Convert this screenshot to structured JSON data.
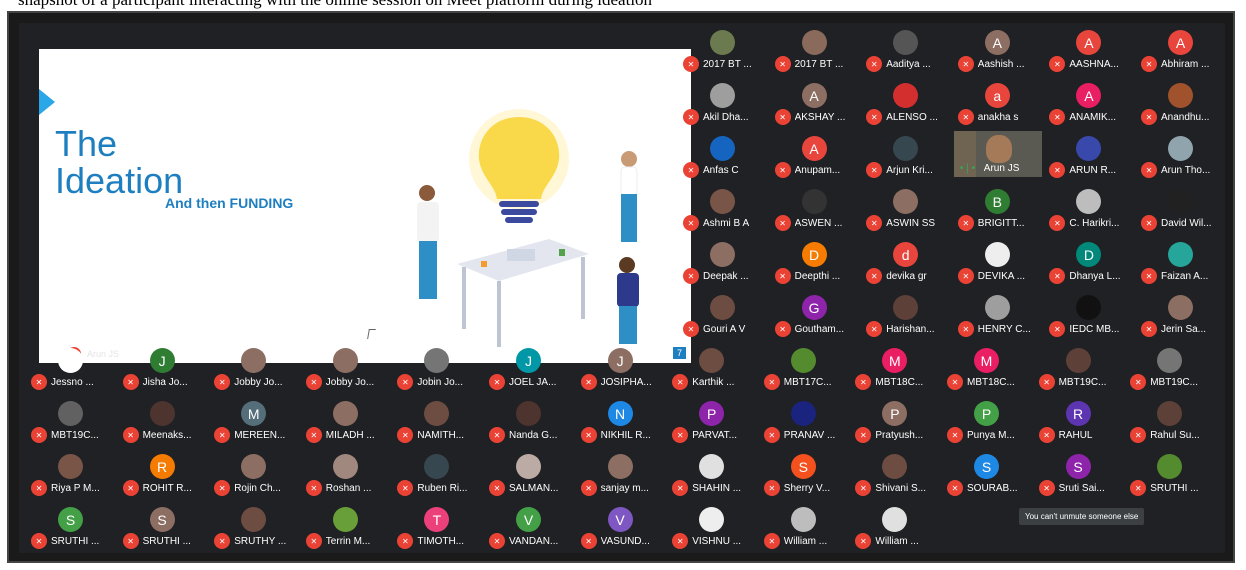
{
  "top_caption": "snapshot of a participant interacting with the online session on Meet platform during ideation",
  "slide": {
    "title_lines": [
      "The",
      "Ideation"
    ],
    "subtitle": "And then FUNDING",
    "page_number": "7",
    "presenter": "Arun JS"
  },
  "tooltip": "You can't unmute someone else",
  "colors": {
    "mute_red": "#ea4335",
    "slide_blue": "#1e7fc0",
    "meet_bg": "#202124"
  },
  "participants": [
    {
      "name": "2017 BT ...",
      "initial": "",
      "avatar_color": "#6b7b4f",
      "video": false
    },
    {
      "name": "2017 BT ...",
      "initial": "",
      "avatar_color": "#8a6a5a",
      "video": false
    },
    {
      "name": "Aaditya ...",
      "initial": "",
      "avatar_color": "#555555",
      "video": false
    },
    {
      "name": "Aashish ...",
      "initial": "A",
      "avatar_color": "#8d6e63",
      "video": false
    },
    {
      "name": "AASHNA...",
      "initial": "A",
      "avatar_color": "#e8453c",
      "video": false
    },
    {
      "name": "Abhiram ...",
      "initial": "A",
      "avatar_color": "#e8453c",
      "video": false
    },
    {
      "name": "Akil Dha...",
      "initial": "",
      "avatar_color": "#9e9e9e",
      "video": false
    },
    {
      "name": "AKSHAY ...",
      "initial": "A",
      "avatar_color": "#8d6e63",
      "video": false
    },
    {
      "name": "ALENSO ...",
      "initial": "",
      "avatar_color": "#d32f2f",
      "video": false
    },
    {
      "name": "anakha s",
      "initial": "a",
      "avatar_color": "#e8453c",
      "video": false
    },
    {
      "name": "ANAMIK...",
      "initial": "A",
      "avatar_color": "#e91e63",
      "video": false
    },
    {
      "name": "Anandhu...",
      "initial": "",
      "avatar_color": "#a0522d",
      "video": false
    },
    {
      "name": "Anfas C",
      "initial": "",
      "avatar_color": "#1565c0",
      "video": false
    },
    {
      "name": "Anupam...",
      "initial": "A",
      "avatar_color": "#e8453c",
      "video": false
    },
    {
      "name": "Arjun Kri...",
      "initial": "",
      "avatar_color": "#37474f",
      "video": false
    },
    {
      "name": "Arun JS",
      "initial": "",
      "avatar_color": "#5a5a52",
      "video": true
    },
    {
      "name": "ARUN R...",
      "initial": "",
      "avatar_color": "#3949ab",
      "video": false
    },
    {
      "name": "Arun Tho...",
      "initial": "",
      "avatar_color": "#90a4ae",
      "video": false
    },
    {
      "name": "Ashmi B A",
      "initial": "",
      "avatar_color": "#795548",
      "video": false
    },
    {
      "name": "ASWEN ...",
      "initial": "",
      "avatar_color": "#333333",
      "video": false
    },
    {
      "name": "ASWIN SS",
      "initial": "",
      "avatar_color": "#8d6e63",
      "video": false
    },
    {
      "name": "BRIGITT...",
      "initial": "B",
      "avatar_color": "#2e7d32",
      "video": false
    },
    {
      "name": "C. Harikri...",
      "initial": "",
      "avatar_color": "#bdbdbd",
      "video": false
    },
    {
      "name": "David Wil...",
      "initial": "",
      "avatar_color": "#212121",
      "video": false
    },
    {
      "name": "Deepak ...",
      "initial": "",
      "avatar_color": "#8d6e63",
      "video": false
    },
    {
      "name": "Deepthi ...",
      "initial": "D",
      "avatar_color": "#f57c00",
      "video": false
    },
    {
      "name": "devika gr",
      "initial": "d",
      "avatar_color": "#e8453c",
      "video": false
    },
    {
      "name": "DEVIKA ...",
      "initial": "",
      "avatar_color": "#eeeeee",
      "video": false
    },
    {
      "name": "Dhanya L...",
      "initial": "D",
      "avatar_color": "#00897b",
      "video": false
    },
    {
      "name": "Faizan A...",
      "initial": "",
      "avatar_color": "#26a69a",
      "video": false
    },
    {
      "name": "Gouri A V",
      "initial": "",
      "avatar_color": "#6d4c41",
      "video": false
    },
    {
      "name": "Goutham...",
      "initial": "G",
      "avatar_color": "#8e24aa",
      "video": false
    },
    {
      "name": "Harishan...",
      "initial": "",
      "avatar_color": "#5d4037",
      "video": false
    },
    {
      "name": "HENRY C...",
      "initial": "",
      "avatar_color": "#9e9e9e",
      "video": false
    },
    {
      "name": "IEDC MB...",
      "initial": "",
      "avatar_color": "#111111",
      "video": false
    },
    {
      "name": "Jerin Sa...",
      "initial": "",
      "avatar_color": "#8d6e63",
      "video": false
    },
    {
      "name": "Jessno ...",
      "initial": "",
      "avatar_color": "#ffffff",
      "video": false
    },
    {
      "name": "Jisha Jo...",
      "initial": "J",
      "avatar_color": "#2e7d32",
      "video": false
    },
    {
      "name": "Jobby Jo...",
      "initial": "",
      "avatar_color": "#8d6e63",
      "video": false
    },
    {
      "name": "Jobby Jo...",
      "initial": "",
      "avatar_color": "#8d6e63",
      "video": false
    },
    {
      "name": "Jobin Jo...",
      "initial": "",
      "avatar_color": "#757575",
      "video": false
    },
    {
      "name": "JOEL JA...",
      "initial": "J",
      "avatar_color": "#0097a7",
      "video": false
    },
    {
      "name": "JOSIPHA...",
      "initial": "J",
      "avatar_color": "#8d6e63",
      "video": false
    },
    {
      "name": "Karthik ...",
      "initial": "",
      "avatar_color": "#6d4c41",
      "video": false
    },
    {
      "name": "MBT17C...",
      "initial": "",
      "avatar_color": "#558b2f",
      "video": false
    },
    {
      "name": "MBT18C...",
      "initial": "M",
      "avatar_color": "#e91e63",
      "video": false
    },
    {
      "name": "MBT18C...",
      "initial": "M",
      "avatar_color": "#e91e63",
      "video": false
    },
    {
      "name": "MBT19C...",
      "initial": "",
      "avatar_color": "#5d4037",
      "video": false
    },
    {
      "name": "MBT19C...",
      "initial": "",
      "avatar_color": "#757575",
      "video": false
    },
    {
      "name": "MBT19C...",
      "initial": "",
      "avatar_color": "#616161",
      "video": false
    },
    {
      "name": "Meenaks...",
      "initial": "",
      "avatar_color": "#4e342e",
      "video": false
    },
    {
      "name": "MEREEN...",
      "initial": "M",
      "avatar_color": "#546e7a",
      "video": false
    },
    {
      "name": "MILADH ...",
      "initial": "",
      "avatar_color": "#8d6e63",
      "video": false
    },
    {
      "name": "NAMITH...",
      "initial": "",
      "avatar_color": "#6d4c41",
      "video": false
    },
    {
      "name": "Nanda G...",
      "initial": "",
      "avatar_color": "#4e342e",
      "video": false
    },
    {
      "name": "NIKHIL R...",
      "initial": "N",
      "avatar_color": "#1e88e5",
      "video": false
    },
    {
      "name": "PARVAT...",
      "initial": "P",
      "avatar_color": "#8e24aa",
      "video": false
    },
    {
      "name": "PRANAV ...",
      "initial": "",
      "avatar_color": "#1a237e",
      "video": false
    },
    {
      "name": "Pratyush...",
      "initial": "P",
      "avatar_color": "#8d6e63",
      "video": false
    },
    {
      "name": "Punya M...",
      "initial": "P",
      "avatar_color": "#43a047",
      "video": false
    },
    {
      "name": "RAHUL",
      "initial": "R",
      "avatar_color": "#5e35b1",
      "video": false
    },
    {
      "name": "Rahul Su...",
      "initial": "",
      "avatar_color": "#5d4037",
      "video": false
    },
    {
      "name": "Riya P M...",
      "initial": "",
      "avatar_color": "#795548",
      "video": false
    },
    {
      "name": "ROHIT R...",
      "initial": "R",
      "avatar_color": "#f57c00",
      "video": false
    },
    {
      "name": "Rojin Ch...",
      "initial": "",
      "avatar_color": "#8d6e63",
      "video": false
    },
    {
      "name": "Roshan ...",
      "initial": "",
      "avatar_color": "#a1887f",
      "video": false
    },
    {
      "name": "Ruben Ri...",
      "initial": "",
      "avatar_color": "#37474f",
      "video": false
    },
    {
      "name": "SALMAN...",
      "initial": "",
      "avatar_color": "#bcaaa4",
      "video": false
    },
    {
      "name": "sanjay m...",
      "initial": "",
      "avatar_color": "#8d6e63",
      "video": false
    },
    {
      "name": "SHAHIN ...",
      "initial": "",
      "avatar_color": "#e0e0e0",
      "video": false
    },
    {
      "name": "Sherry V...",
      "initial": "S",
      "avatar_color": "#f4511e",
      "video": false
    },
    {
      "name": "Shivani S...",
      "initial": "",
      "avatar_color": "#6d4c41",
      "video": false
    },
    {
      "name": "SOURAB...",
      "initial": "S",
      "avatar_color": "#1e88e5",
      "video": false
    },
    {
      "name": "Sruti Sai...",
      "initial": "S",
      "avatar_color": "#8e24aa",
      "video": false
    },
    {
      "name": "SRUTHI ...",
      "initial": "",
      "avatar_color": "#558b2f",
      "video": false
    },
    {
      "name": "SRUTHI ...",
      "initial": "S",
      "avatar_color": "#43a047",
      "video": false
    },
    {
      "name": "SRUTHI ...",
      "initial": "S",
      "avatar_color": "#8d6e63",
      "video": false
    },
    {
      "name": "SRUTHY ...",
      "initial": "",
      "avatar_color": "#6d4c41",
      "video": false
    },
    {
      "name": "Terrin M...",
      "initial": "",
      "avatar_color": "#689f38",
      "video": false
    },
    {
      "name": "TIMOTH...",
      "initial": "T",
      "avatar_color": "#ec407a",
      "video": false
    },
    {
      "name": "VANDAN...",
      "initial": "V",
      "avatar_color": "#43a047",
      "video": false
    },
    {
      "name": "VASUND...",
      "initial": "V",
      "avatar_color": "#7e57c2",
      "video": false
    },
    {
      "name": "VISHNU ...",
      "initial": "",
      "avatar_color": "#eeeeee",
      "video": false
    },
    {
      "name": "William ...",
      "initial": "",
      "avatar_color": "#bdbdbd",
      "video": false
    },
    {
      "name": "William ...",
      "initial": "",
      "avatar_color": "#e0e0e0",
      "video": false
    }
  ]
}
